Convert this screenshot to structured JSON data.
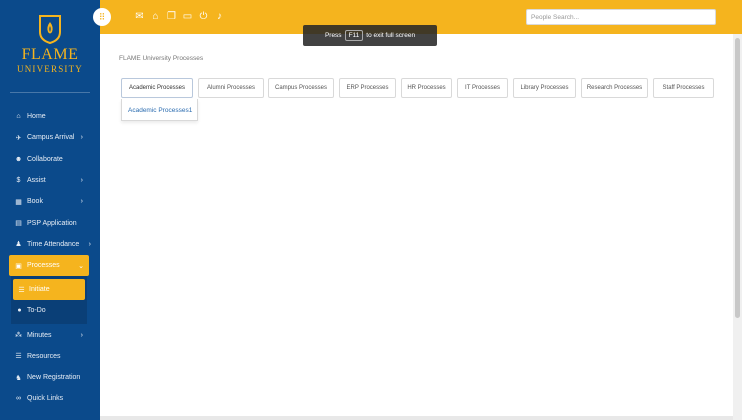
{
  "brand": {
    "name": "FLAME",
    "subtitle": "UNIVERSITY",
    "color": "#f5b41e"
  },
  "colors": {
    "sidebar": "#0b4a8b",
    "accent": "#f5b41e",
    "link": "#2b6cb0"
  },
  "topbar": {
    "menu_icon": "grip-icon",
    "icons": [
      "mail-icon",
      "graduation-cap-icon",
      "documents-icon",
      "monitor-icon",
      "power-icon",
      "bell-icon"
    ],
    "search_placeholder": "People Search..."
  },
  "toast": {
    "prefix": "Press",
    "key": "F11",
    "suffix": "to exit full screen"
  },
  "sidebar": {
    "items": [
      {
        "label": "Home",
        "icon": "home-icon",
        "chevron": ""
      },
      {
        "label": "Campus Arrival",
        "icon": "plane-icon",
        "chevron": "›"
      },
      {
        "label": "Collaborate",
        "icon": "users-icon",
        "chevron": ""
      },
      {
        "label": "Assist",
        "icon": "dollar-icon",
        "chevron": "›"
      },
      {
        "label": "Book",
        "icon": "calendar-icon",
        "chevron": "›"
      },
      {
        "label": "PSP Application",
        "icon": "file-icon",
        "chevron": ""
      },
      {
        "label": "Time Attendance",
        "icon": "user-clock-icon",
        "chevron": "›"
      },
      {
        "label": "Processes",
        "icon": "tasks-icon",
        "chevron": "⌄"
      }
    ],
    "subitems": [
      {
        "label": "Initiate",
        "icon": "list-icon"
      },
      {
        "label": "To-Do",
        "icon": "circle-check-icon"
      }
    ],
    "items_after": [
      {
        "label": "Minutes",
        "icon": "sitemap-icon",
        "chevron": "›"
      },
      {
        "label": "Resources",
        "icon": "list-icon",
        "chevron": ""
      },
      {
        "label": "New Registration",
        "icon": "user-plus-icon",
        "chevron": ""
      },
      {
        "label": "Quick Links",
        "icon": "link-icon",
        "chevron": ""
      }
    ]
  },
  "main": {
    "breadcrumb": "FLAME University Processes",
    "tabs": [
      "Academic Processes",
      "Alumni Processes",
      "Campus Processes",
      "ERP Processes",
      "HR Processes",
      "IT Processes",
      "Library Processes",
      "Research Processes",
      "Staff Processes"
    ],
    "dropdown_items": [
      "Academic Processes1"
    ]
  }
}
